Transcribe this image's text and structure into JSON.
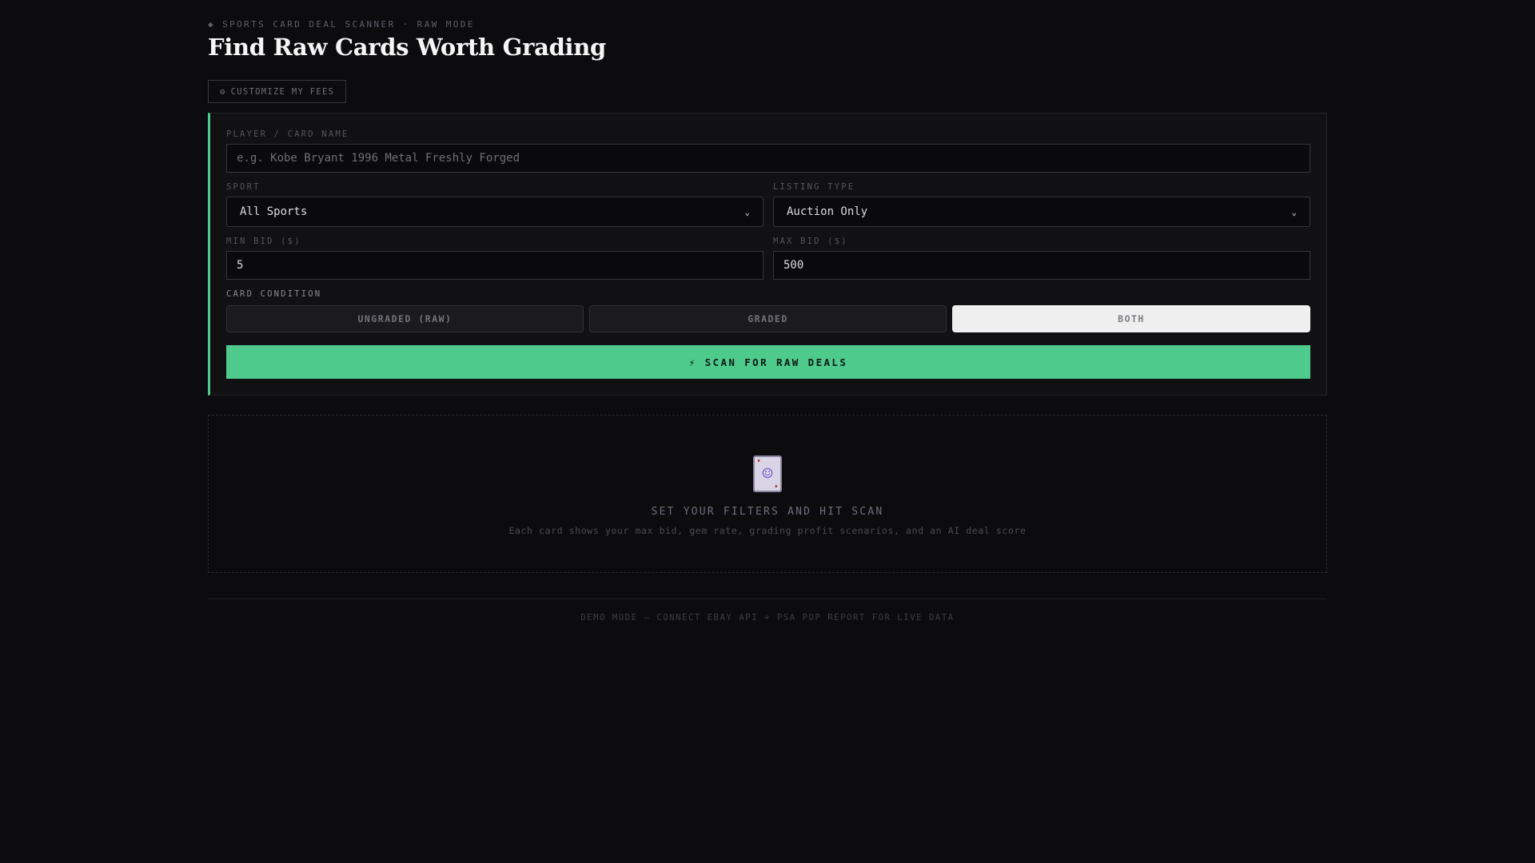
{
  "header": {
    "eyebrow_icon": "◆",
    "eyebrow": "SPORTS CARD DEAL SCANNER · RAW MODE",
    "title": "Find Raw Cards Worth Grading"
  },
  "fees_button": {
    "icon": "⚙",
    "label": "CUSTOMIZE MY FEES"
  },
  "form": {
    "player": {
      "label": "PLAYER / CARD NAME",
      "value": "",
      "placeholder": "e.g. Kobe Bryant 1996 Metal Freshly Forged"
    },
    "sport": {
      "label": "SPORT",
      "selected": "All Sports"
    },
    "listing_type": {
      "label": "LISTING TYPE",
      "selected": "Auction Only"
    },
    "min_bid": {
      "label": "MIN BID ($)",
      "value": "5"
    },
    "max_bid": {
      "label": "MAX BID ($)",
      "value": "500"
    },
    "condition": {
      "label": "CARD CONDITION",
      "options": [
        "UNGRADED (RAW)",
        "GRADED",
        "BOTH"
      ],
      "selected": "BOTH"
    },
    "scan_button": {
      "icon": "⚡",
      "label": "SCAN FOR RAW DEALS"
    }
  },
  "empty_state": {
    "icon": "joker-card-icon",
    "title": "SET YOUR FILTERS AND HIT SCAN",
    "subtitle": "Each card shows your max bid, gem rate, grading profit scenarios, and an AI deal score"
  },
  "footer": "DEMO MODE — CONNECT EBAY API + PSA POP REPORT FOR LIVE DATA",
  "colors": {
    "accent": "#4ecb8c",
    "background": "#0c0c0e",
    "panel": "#111114"
  }
}
